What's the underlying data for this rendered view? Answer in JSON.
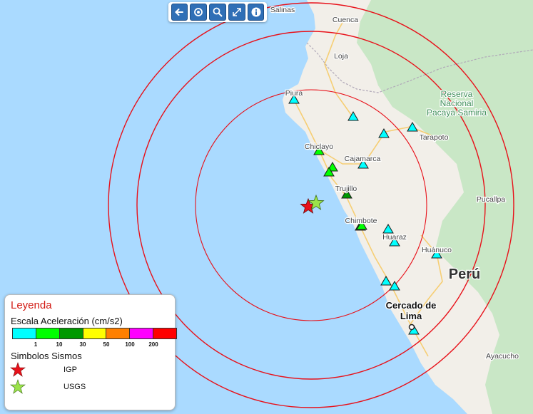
{
  "map": {
    "country_label": "Perú",
    "place_labels": [
      {
        "name": "Salinas",
        "kind": "town"
      },
      {
        "name": "Cuenca",
        "kind": "city"
      },
      {
        "name": "Loja",
        "kind": "town"
      },
      {
        "name": "Piura",
        "kind": "city"
      },
      {
        "name": "Chiclayo",
        "kind": "city"
      },
      {
        "name": "Cajamarca",
        "kind": "city"
      },
      {
        "name": "Trujillo",
        "kind": "city"
      },
      {
        "name": "Chimbote",
        "kind": "city"
      },
      {
        "name": "Huaraz",
        "kind": "town"
      },
      {
        "name": "Huánuco",
        "kind": "town"
      },
      {
        "name": "Tarapoto",
        "kind": "city"
      },
      {
        "name": "Pucallpa",
        "kind": "city"
      },
      {
        "name": "Cercado de Lima",
        "kind": "capital"
      },
      {
        "name": "Ayacucho",
        "kind": "town"
      },
      {
        "name": "Reserva Nacional Pacaya Samiria",
        "kind": "park"
      }
    ],
    "stations": [
      {
        "level": "cyan"
      },
      {
        "level": "cyan"
      },
      {
        "level": "cyan"
      },
      {
        "level": "cyan"
      },
      {
        "level": "green"
      },
      {
        "level": "green"
      },
      {
        "level": "cyan"
      },
      {
        "level": "green"
      },
      {
        "level": "darkgreen"
      },
      {
        "level": "darkgreen"
      },
      {
        "level": "cyan"
      },
      {
        "level": "cyan"
      },
      {
        "level": "cyan"
      },
      {
        "level": "cyan"
      },
      {
        "level": "cyan"
      },
      {
        "level": "cyan"
      },
      {
        "level": "green"
      }
    ],
    "colors": {
      "ocean": "#aadaff",
      "land": "#f2efe9",
      "forest": "#c9e7c6",
      "circle": "#e8111a",
      "igp_star": "#e8111a",
      "usgs_star": "#9be34a"
    }
  },
  "toolbar": {
    "buttons": [
      {
        "icon": "arrow-left-icon"
      },
      {
        "icon": "locate-icon"
      },
      {
        "icon": "zoom-icon"
      },
      {
        "icon": "expand-icon"
      },
      {
        "icon": "info-icon"
      }
    ]
  },
  "legend": {
    "title": "Leyenda",
    "scale_title": "Escala Aceleración (cm/s2)",
    "scale_colors": [
      "#00ffff",
      "#00ff00",
      "#009900",
      "#ffff00",
      "#ff8000",
      "#ff00ff",
      "#ff0000"
    ],
    "scale_ticks": [
      "1",
      "10",
      "30",
      "50",
      "100",
      "200"
    ],
    "symbols_title": "Simbolos Sismos",
    "symbols": [
      {
        "label": "IGP",
        "color": "#e8111a"
      },
      {
        "label": "USGS",
        "color": "#9be34a"
      }
    ]
  }
}
